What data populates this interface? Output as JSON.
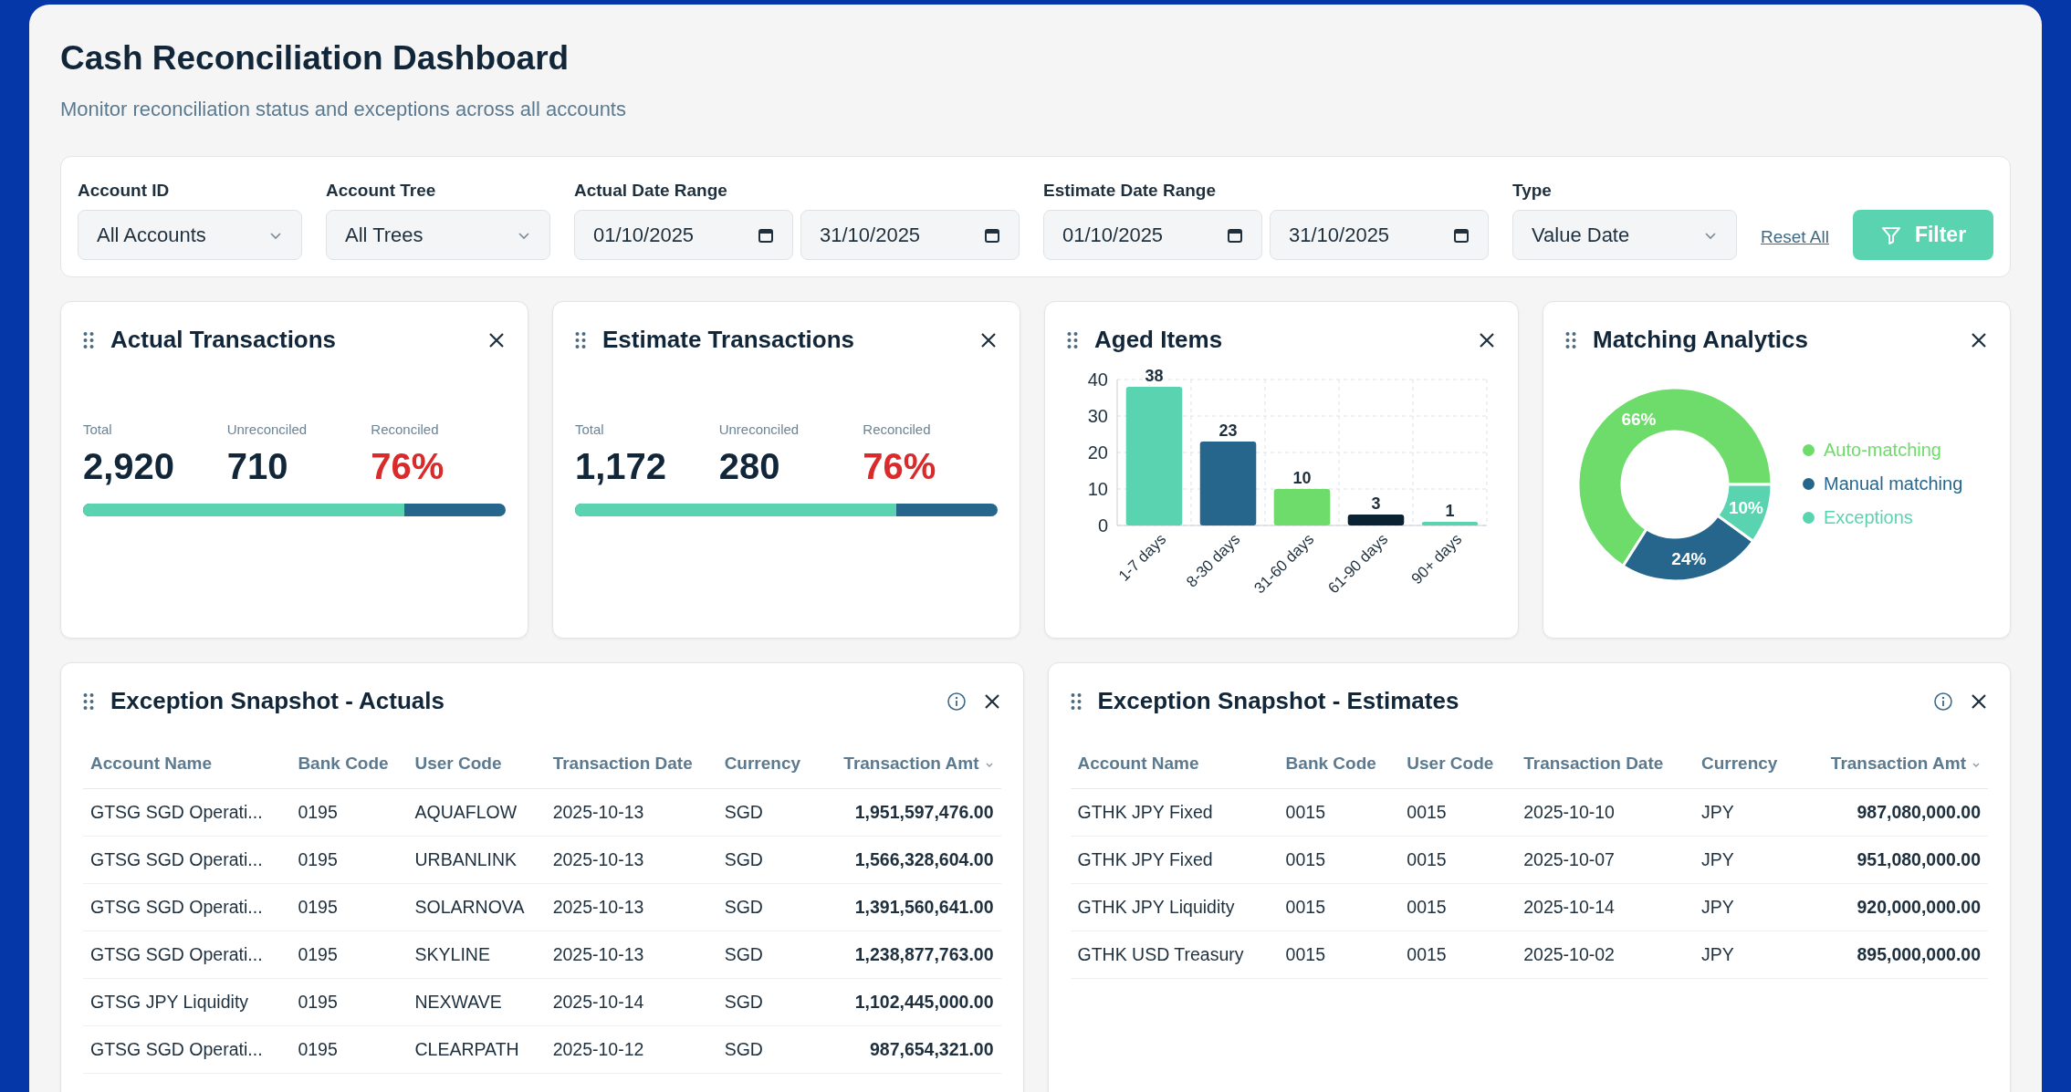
{
  "header": {
    "title": "Cash Reconciliation Dashboard",
    "subtitle": "Monitor reconciliation status and exceptions across all accounts"
  },
  "filters": [
    {
      "label": "Account ID",
      "kind": "select",
      "values": [
        "All Accounts"
      ]
    },
    {
      "label": "Account Tree",
      "kind": "select",
      "values": [
        "All Trees"
      ]
    },
    {
      "label": "Actual Date Range",
      "kind": "date_range",
      "values": [
        "01/10/2025",
        "31/10/2025"
      ]
    },
    {
      "label": "Estimate Date Range",
      "kind": "date_range",
      "values": [
        "01/10/2025",
        "31/10/2025"
      ]
    },
    {
      "label": "Type",
      "kind": "select",
      "values": [
        "Value Date"
      ]
    }
  ],
  "reset_link": "Reset All",
  "filter_button": "Filter",
  "cards": [
    {
      "kind": "stats",
      "title": "Actual Transactions",
      "stats": [
        {
          "label": "Total",
          "value": "2,920",
          "color": "#12263a"
        },
        {
          "label": "Unreconciled",
          "value": "710",
          "color": "#12263a"
        },
        {
          "label": "Reconciled",
          "value": "76%",
          "color": "#d92b2b"
        }
      ],
      "level": 0.76
    },
    {
      "kind": "stats",
      "title": "Estimate Transactions",
      "stats": [
        {
          "label": "Total",
          "value": "1,172",
          "color": "#12263a"
        },
        {
          "label": "Unreconciled",
          "value": "280",
          "color": "#12263a"
        },
        {
          "label": "Reconciled",
          "value": "76%",
          "color": "#d92b2b"
        }
      ],
      "level": 0.76
    },
    {
      "kind": "bar",
      "title": "Aged Items",
      "chart_data": {
        "type": "bar",
        "categories": [
          "1-7 days",
          "8-30 days",
          "31-60 days",
          "61-90 days",
          "90+ days"
        ],
        "values": [
          38,
          23,
          10,
          3,
          1
        ],
        "colors": [
          "#5ad4b0",
          "#27668c",
          "#6ddc6a",
          "#0b2233",
          "#5ad4b0"
        ],
        "ylim": [
          0,
          40
        ],
        "grid": true,
        "yticks": [
          0,
          10,
          20,
          30,
          40
        ],
        "data_labels": true
      }
    },
    {
      "kind": "donut",
      "title": "Matching Analytics",
      "chart_data": {
        "type": "donut",
        "categories": [
          "Auto-matching",
          "Manual matching",
          "Exceptions"
        ],
        "values": [
          66,
          24,
          10
        ],
        "colors": [
          "#6ddc6a",
          "#27668c",
          "#5ad4b0"
        ],
        "value_labels": [
          "66%",
          "24%",
          "10%"
        ]
      }
    }
  ],
  "tables": [
    {
      "title": "Exception Snapshot - Actuals",
      "columns": [
        {
          "label": "Account Name",
          "sorted": false
        },
        {
          "label": "Bank Code",
          "sorted": false
        },
        {
          "label": "User Code",
          "sorted": false
        },
        {
          "label": "Transaction Date",
          "sorted": false
        },
        {
          "label": "Currency",
          "sorted": false
        },
        {
          "label": "Transaction Amt",
          "sorted": true
        }
      ],
      "rows": [
        [
          "GTSG SGD Operati...",
          "0195",
          "AQUAFLOW",
          "2025-10-13",
          "SGD",
          "1,951,597,476.00"
        ],
        [
          "GTSG SGD Operati...",
          "0195",
          "URBANLINK",
          "2025-10-13",
          "SGD",
          "1,566,328,604.00"
        ],
        [
          "GTSG SGD Operati...",
          "0195",
          "SOLARNOVA",
          "2025-10-13",
          "SGD",
          "1,391,560,641.00"
        ],
        [
          "GTSG SGD Operati...",
          "0195",
          "SKYLINE",
          "2025-10-13",
          "SGD",
          "1,238,877,763.00"
        ],
        [
          "GTSG JPY Liquidity",
          "0195",
          "NEXWAVE",
          "2025-10-14",
          "SGD",
          "1,102,445,000.00"
        ],
        [
          "GTSG SGD Operati...",
          "0195",
          "CLEARPATH",
          "2025-10-12",
          "SGD",
          "987,654,321.00"
        ]
      ]
    },
    {
      "title": "Exception Snapshot - Estimates",
      "columns": [
        {
          "label": "Account Name",
          "sorted": false
        },
        {
          "label": "Bank Code",
          "sorted": false
        },
        {
          "label": "User Code",
          "sorted": false
        },
        {
          "label": "Transaction Date",
          "sorted": false
        },
        {
          "label": "Currency",
          "sorted": false
        },
        {
          "label": "Transaction Amt",
          "sorted": true
        }
      ],
      "rows": [
        [
          "GTHK JPY Fixed",
          "0015",
          "0015",
          "2025-10-10",
          "JPY",
          "987,080,000.00"
        ],
        [
          "GTHK JPY Fixed",
          "0015",
          "0015",
          "2025-10-07",
          "JPY",
          "951,080,000.00"
        ],
        [
          "GTHK JPY Liquidity",
          "0015",
          "0015",
          "2025-10-14",
          "JPY",
          "920,000,000.00"
        ],
        [
          "GTHK USD Treasury",
          "0015",
          "0015",
          "2025-10-02",
          "JPY",
          "895,000,000.00"
        ]
      ]
    }
  ]
}
